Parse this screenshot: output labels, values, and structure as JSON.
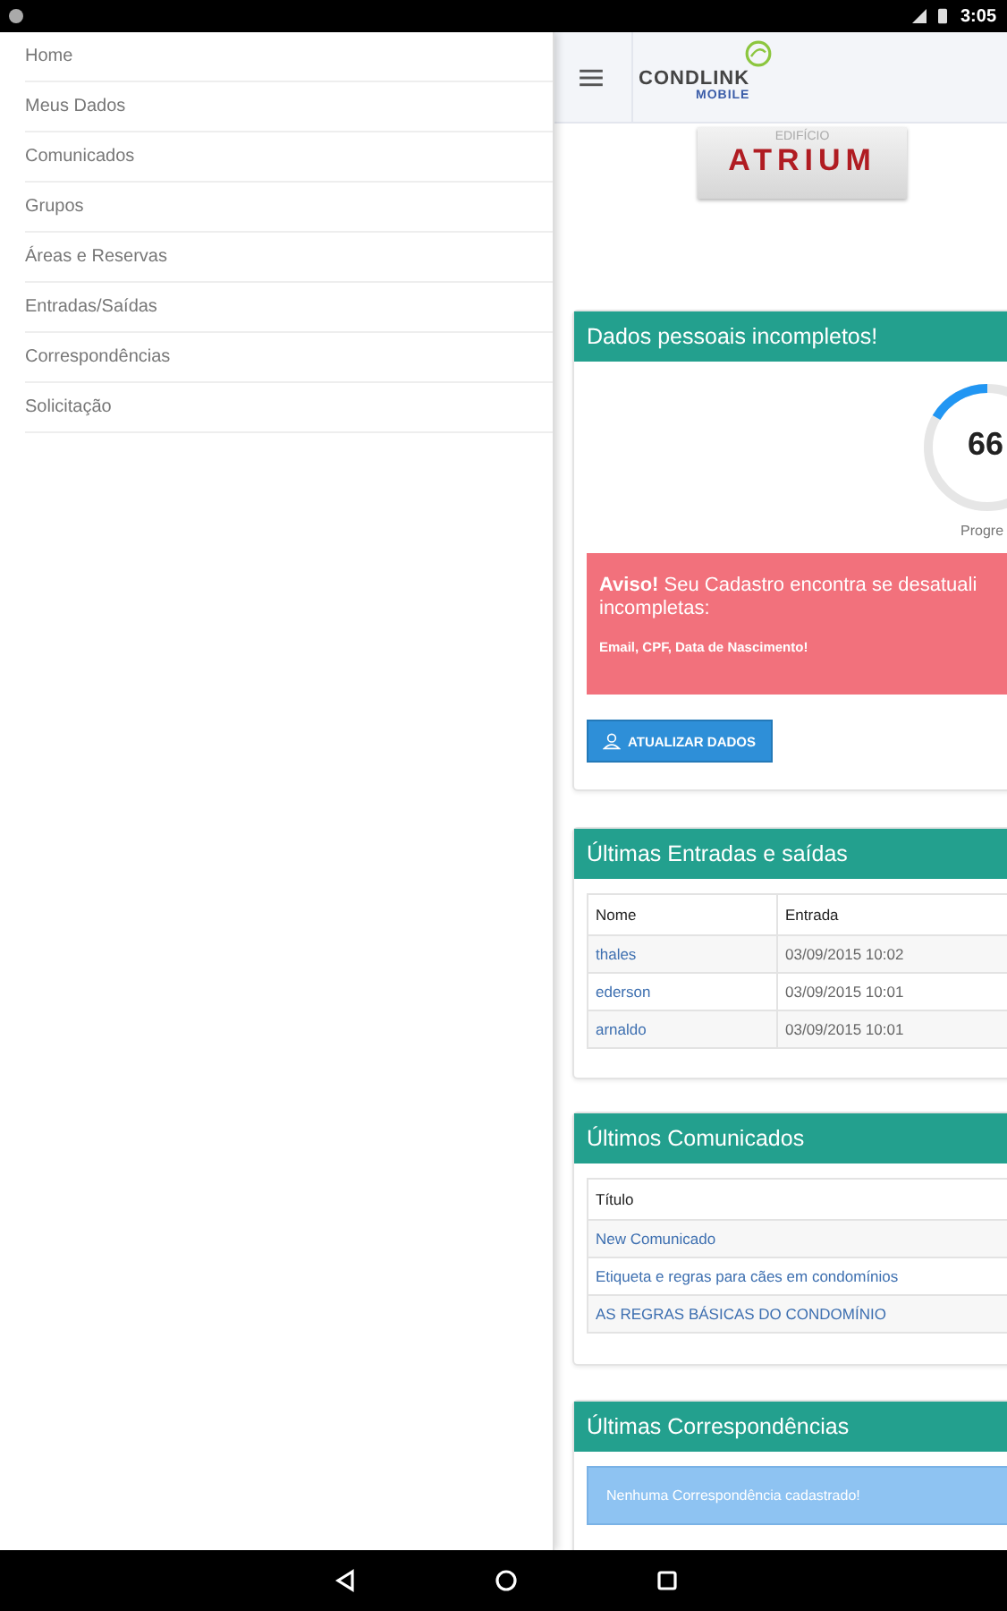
{
  "status_bar": {
    "time": "3:05"
  },
  "drawer": {
    "items": [
      {
        "label": "Home"
      },
      {
        "label": "Meus Dados"
      },
      {
        "label": "Comunicados"
      },
      {
        "label": "Grupos"
      },
      {
        "label": "Áreas e Reservas"
      },
      {
        "label": "Entradas/Saídas"
      },
      {
        "label": "Correspondências"
      },
      {
        "label": "Solicitação"
      }
    ]
  },
  "header": {
    "logo_text": "CONDLINK",
    "logo_subtext": "MOBILE"
  },
  "building_logo": {
    "caption": "EDIFÍCIO",
    "name": "ATRIUM"
  },
  "profile_card": {
    "title": "Dados pessoais incompletos!",
    "progress": {
      "value": "66",
      "caption": "Progre"
    },
    "alert": {
      "line1": "**Aviso!** Seu Cadastro encontra se desatuali",
      "line2": "incompletas:",
      "fields": "Email, CPF, Data de Nascimento!"
    },
    "button": "ATUALIZAR DADOS"
  },
  "entries_card": {
    "title": "Últimas Entradas e saídas",
    "columns": [
      "Nome",
      "Entrada"
    ],
    "rows": [
      [
        "thales",
        "03/09/2015 10:02"
      ],
      [
        "ederson",
        "03/09/2015 10:01"
      ],
      [
        "arnaldo",
        "03/09/2015 10:01"
      ]
    ]
  },
  "notices_card": {
    "title": "Últimos Comunicados",
    "columns": [
      "Título"
    ],
    "rows": [
      [
        "New Comunicado"
      ],
      [
        "Etiqueta e regras para cães em condomínios"
      ],
      [
        "AS REGRAS BÁSICAS DO CONDOMÍNIO"
      ]
    ]
  },
  "mail_card": {
    "title": "Últimas Correspondências",
    "message": "Nenhuma Correspondência cadastrado!"
  }
}
